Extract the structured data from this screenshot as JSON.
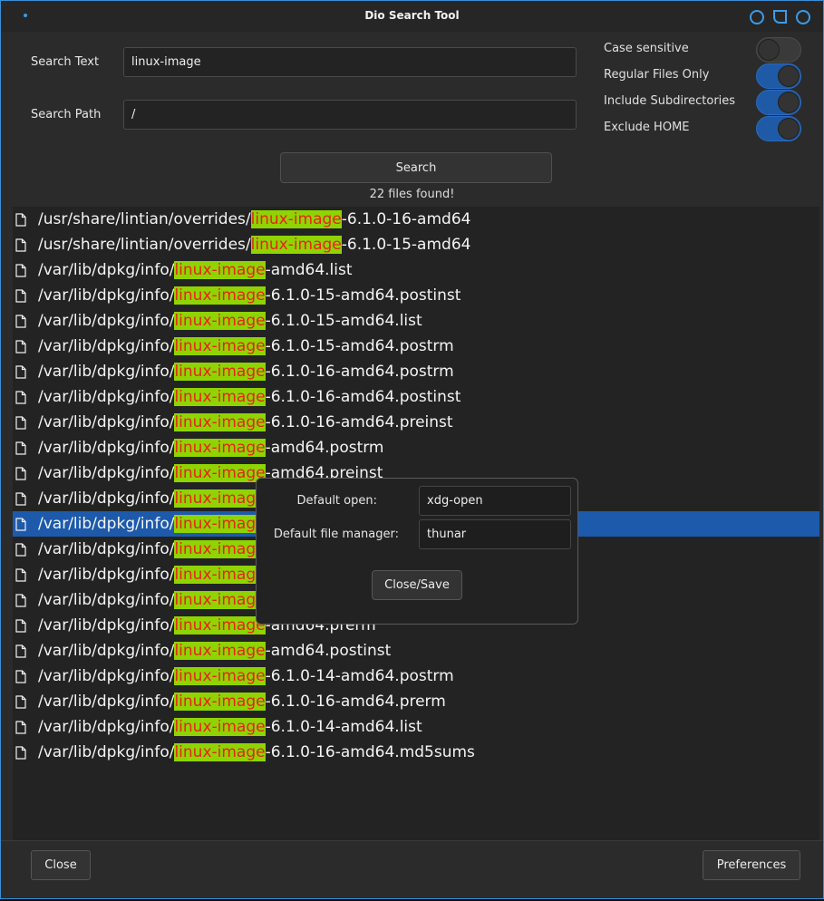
{
  "window": {
    "title": "Dio Search Tool"
  },
  "form": {
    "search_text_label": "Search Text",
    "search_text_value": "linux-image",
    "search_path_label": "Search Path",
    "search_path_value": "/",
    "search_button": "Search",
    "result_count": "22 files found!"
  },
  "options": [
    {
      "label": "Case sensitive",
      "on": false
    },
    {
      "label": "Regular Files Only",
      "on": true
    },
    {
      "label": "Include Subdirectories",
      "on": true
    },
    {
      "label": "Exclude HOME",
      "on": true
    }
  ],
  "results": [
    {
      "prefix": "/usr/share/lintian/overrides/",
      "match": "linux-image",
      "suffix": "-6.1.0-16-amd64"
    },
    {
      "prefix": "/usr/share/lintian/overrides/",
      "match": "linux-image",
      "suffix": "-6.1.0-15-amd64"
    },
    {
      "prefix": "/var/lib/dpkg/info/",
      "match": "linux-image",
      "suffix": "-amd64.list"
    },
    {
      "prefix": "/var/lib/dpkg/info/",
      "match": "linux-image",
      "suffix": "-6.1.0-15-amd64.postinst"
    },
    {
      "prefix": "/var/lib/dpkg/info/",
      "match": "linux-image",
      "suffix": "-6.1.0-15-amd64.list"
    },
    {
      "prefix": "/var/lib/dpkg/info/",
      "match": "linux-image",
      "suffix": "-6.1.0-15-amd64.postrm"
    },
    {
      "prefix": "/var/lib/dpkg/info/",
      "match": "linux-image",
      "suffix": "-6.1.0-16-amd64.postrm"
    },
    {
      "prefix": "/var/lib/dpkg/info/",
      "match": "linux-image",
      "suffix": "-6.1.0-16-amd64.postinst"
    },
    {
      "prefix": "/var/lib/dpkg/info/",
      "match": "linux-image",
      "suffix": "-6.1.0-16-amd64.preinst"
    },
    {
      "prefix": "/var/lib/dpkg/info/",
      "match": "linux-image",
      "suffix": "-amd64.postrm"
    },
    {
      "prefix": "/var/lib/dpkg/info/",
      "match": "linux-image",
      "suffix": "-amd64.preinst"
    },
    {
      "prefix": "/var/lib/dpkg/info/",
      "match": "linux-image",
      "suffix": ""
    },
    {
      "prefix": "/var/lib/dpkg/info/",
      "match": "linux-image",
      "suffix": "",
      "selected": true
    },
    {
      "prefix": "/var/lib/dpkg/info/",
      "match": "linux-image",
      "suffix": ""
    },
    {
      "prefix": "/var/lib/dpkg/info/",
      "match": "linux-image",
      "suffix": ""
    },
    {
      "prefix": "/var/lib/dpkg/info/",
      "match": "linux-image",
      "suffix": ""
    },
    {
      "prefix": "/var/lib/dpkg/info/",
      "match": "linux-image",
      "suffix": "-amd64.prerm"
    },
    {
      "prefix": "/var/lib/dpkg/info/",
      "match": "linux-image",
      "suffix": "-amd64.postinst"
    },
    {
      "prefix": "/var/lib/dpkg/info/",
      "match": "linux-image",
      "suffix": "-6.1.0-14-amd64.postrm"
    },
    {
      "prefix": "/var/lib/dpkg/info/",
      "match": "linux-image",
      "suffix": "-6.1.0-16-amd64.prerm"
    },
    {
      "prefix": "/var/lib/dpkg/info/",
      "match": "linux-image",
      "suffix": "-6.1.0-14-amd64.list"
    },
    {
      "prefix": "/var/lib/dpkg/info/",
      "match": "linux-image",
      "suffix": "-6.1.0-16-amd64.md5sums"
    }
  ],
  "prefs": {
    "default_open_label": "Default open:",
    "default_open_value": "xdg-open",
    "file_manager_label": "Default file manager:",
    "file_manager_value": "thunar",
    "close_save": "Close/Save"
  },
  "bottom": {
    "close": "Close",
    "preferences": "Preferences"
  },
  "colors": {
    "accent": "#3b9be8",
    "selection": "#1d5aab",
    "highlight_bg": "#8fd400",
    "highlight_fg": "#e8221a"
  },
  "icons": {
    "window": [
      "window-menu-icon",
      "minimize-icon",
      "maximize-icon",
      "close-icon"
    ],
    "file": "file-icon"
  }
}
